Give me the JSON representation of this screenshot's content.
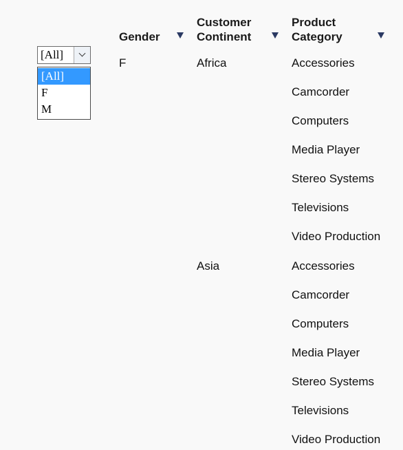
{
  "columns": {
    "gender": "Gender",
    "continent_line1": "Customer",
    "continent_line2": "Continent",
    "category_line1": "Product",
    "category_line2": "Category"
  },
  "filter": {
    "selected": "[All]",
    "options": [
      "[All]",
      "F",
      "M"
    ]
  },
  "rows": {
    "gender": "F",
    "continents": [
      "Africa",
      "Asia"
    ],
    "africa_categories": [
      "Accessories",
      "Camcorder",
      "Computers",
      "Media Player",
      "Stereo Systems",
      "Televisions",
      "Video Production"
    ],
    "asia_categories": [
      "Accessories",
      "Camcorder",
      "Computers",
      "Media Player",
      "Stereo Systems",
      "Televisions",
      "Video Production"
    ]
  }
}
